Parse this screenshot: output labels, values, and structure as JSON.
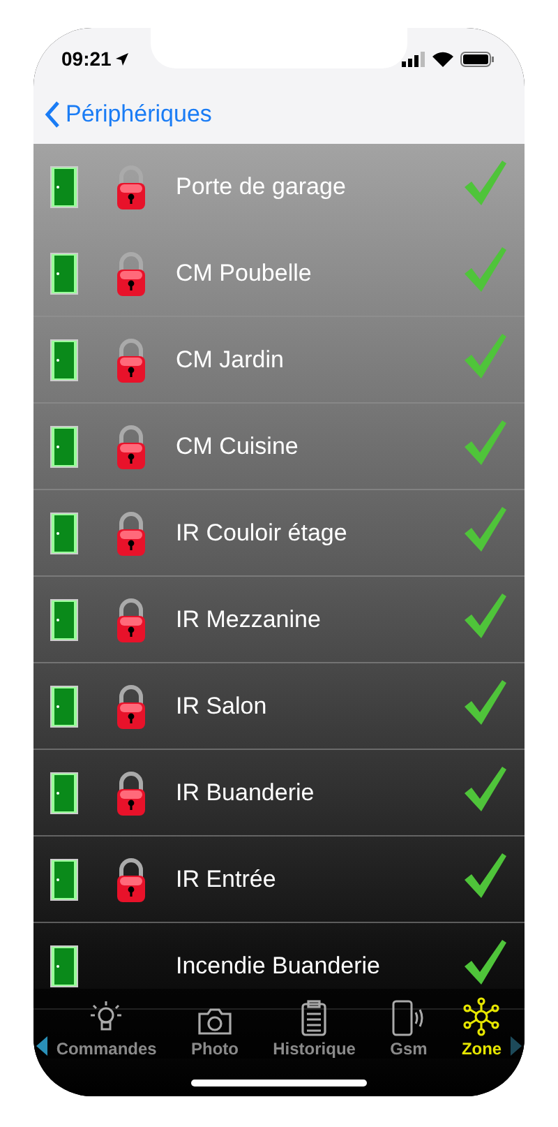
{
  "status_bar": {
    "time": "09:21"
  },
  "nav": {
    "back": "Périphériques"
  },
  "zones": [
    {
      "name": "Porte de garage",
      "locked": true,
      "ok": true
    },
    {
      "name": "CM Poubelle",
      "locked": true,
      "ok": true
    },
    {
      "name": "CM Jardin",
      "locked": true,
      "ok": true
    },
    {
      "name": "CM Cuisine",
      "locked": true,
      "ok": true
    },
    {
      "name": "IR Couloir étage",
      "locked": true,
      "ok": true
    },
    {
      "name": "IR Mezzanine",
      "locked": true,
      "ok": true
    },
    {
      "name": "IR Salon",
      "locked": true,
      "ok": true
    },
    {
      "name": "IR Buanderie",
      "locked": true,
      "ok": true
    },
    {
      "name": "IR Entrée",
      "locked": true,
      "ok": true
    },
    {
      "name": "Incendie Buanderie",
      "locked": false,
      "ok": true
    }
  ],
  "tabs": [
    {
      "label": "Commandes",
      "kind": "bulb",
      "selected": false
    },
    {
      "label": "Photo",
      "kind": "camera",
      "selected": false
    },
    {
      "label": "Historique",
      "kind": "clipboard",
      "selected": false
    },
    {
      "label": "Gsm",
      "kind": "phone",
      "selected": false
    },
    {
      "label": "Zone",
      "kind": "network",
      "selected": true
    }
  ]
}
